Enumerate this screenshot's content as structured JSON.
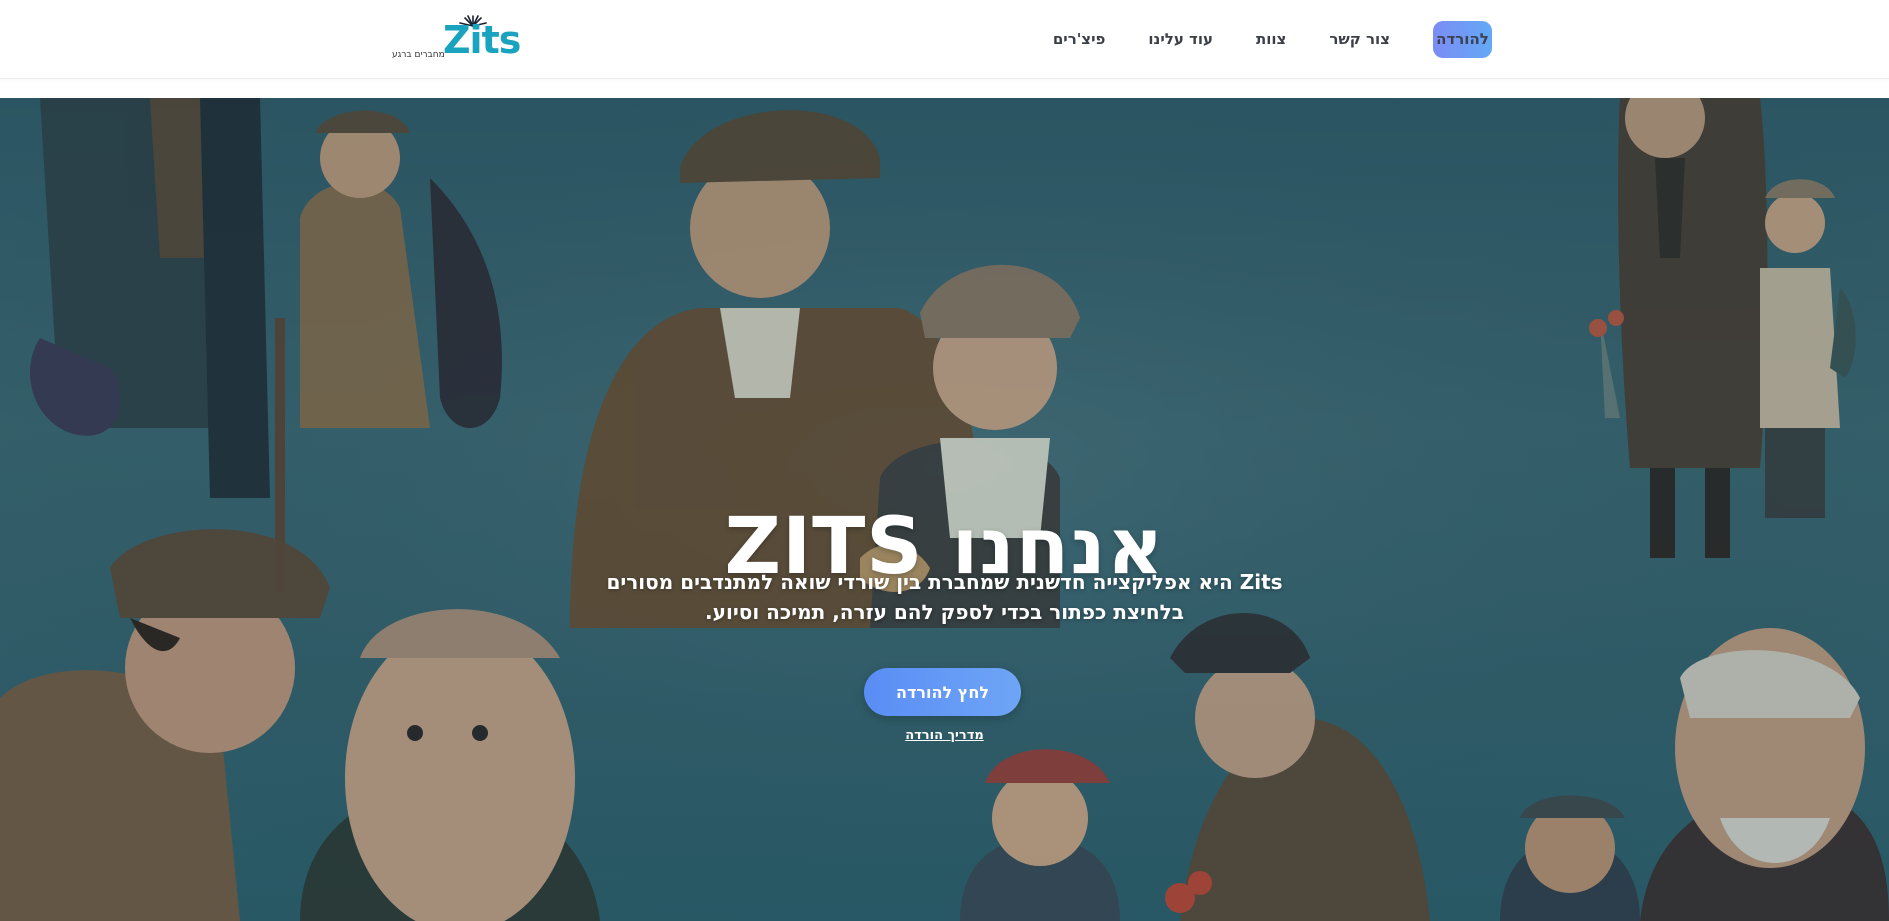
{
  "header": {
    "logo_word": "Zits",
    "logo_tagline": "מחברים ברגע",
    "nav": [
      {
        "label": "פיצ'רים"
      },
      {
        "label": "עוד עלינו"
      },
      {
        "label": "צוות"
      },
      {
        "label": "צור קשר"
      }
    ],
    "download_label": "להורדה"
  },
  "hero": {
    "title": "אנחנו ZITS",
    "description": "Zits היא אפליקצייה חדשנית שמחברת בין שורדי שואה למתנדבים מסורים בלחיצת כפתור בכדי לספק להם עזרה, תמיכה וסיוע.",
    "button_label": "לחץ להורדה",
    "guide_link": "מדריך הורדה"
  },
  "colors": {
    "brand": "#1aa3bf",
    "button_gradient_start": "#5a8df5",
    "button_gradient_end": "#6fa5f6",
    "hero_background": "#3c6670"
  }
}
